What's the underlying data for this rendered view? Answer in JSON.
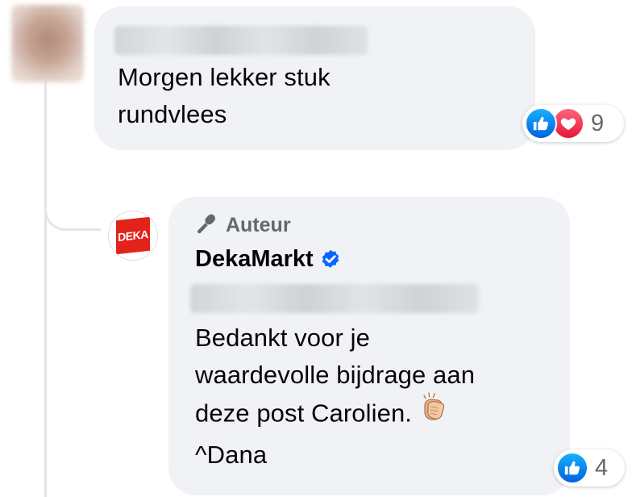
{
  "thread": {
    "comment": {
      "author_name": "",
      "text_lines": [
        "Morgen lekker stuk",
        "rundvlees"
      ],
      "reactions": {
        "types": [
          "like-icon",
          "love-icon"
        ],
        "count": "9"
      }
    },
    "reply": {
      "badge_icon": "microphone-icon",
      "badge_label": "Auteur",
      "page_name": "DekaMarkt",
      "page_logo_text": "DEKA",
      "verified_icon": "verified-badge-icon",
      "mentioned_name": "",
      "text_lines": [
        "Bedankt voor je",
        "waardevolle bijdrage aan",
        "deze post Carolien.",
        "^Dana"
      ],
      "emoji": "clapping-hands-emoji",
      "reactions": {
        "types": [
          "like-icon"
        ],
        "count": "4"
      }
    }
  },
  "colors": {
    "bubble_bg": "#f0f2f5",
    "text": "#050505",
    "secondary_text": "#65676b",
    "like_blue": "#0866ff",
    "love_red": "#f33e58",
    "deka_red": "#e2231a",
    "verified_blue": "#0866ff"
  }
}
